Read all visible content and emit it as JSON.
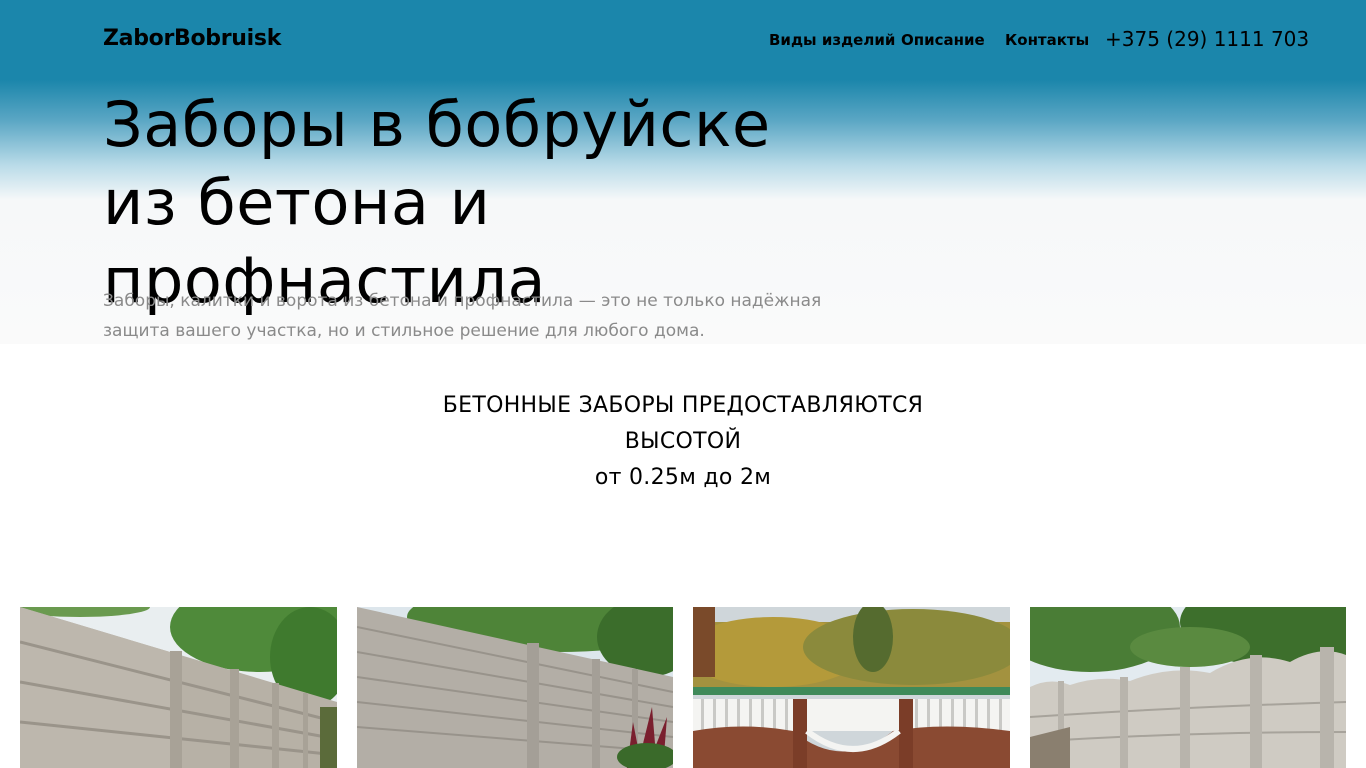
{
  "header": {
    "logo": "ZaborBobruisk",
    "nav": [
      "Виды изделий",
      "Описание",
      "Контакты"
    ],
    "phone": "+375 (29) 1111 703"
  },
  "hero": {
    "title": "Заборы в бобруйске из бетона и профнастила",
    "description": "Заборы, калитки и ворота из бетона и профнастила — это не только надёжная защита вашего участка, но и стильное решение для любого дома."
  },
  "heights": {
    "line1": "БЕТОННЫЕ ЗАБОРЫ ПРЕДОСТАВЛЯЮТСЯ",
    "line2": "ВЫСОТОЙ",
    "line3": "от 0.25м до 2м"
  },
  "colors": {
    "header_bg": "#1b86ab",
    "muted_text": "#8a8a8a"
  }
}
